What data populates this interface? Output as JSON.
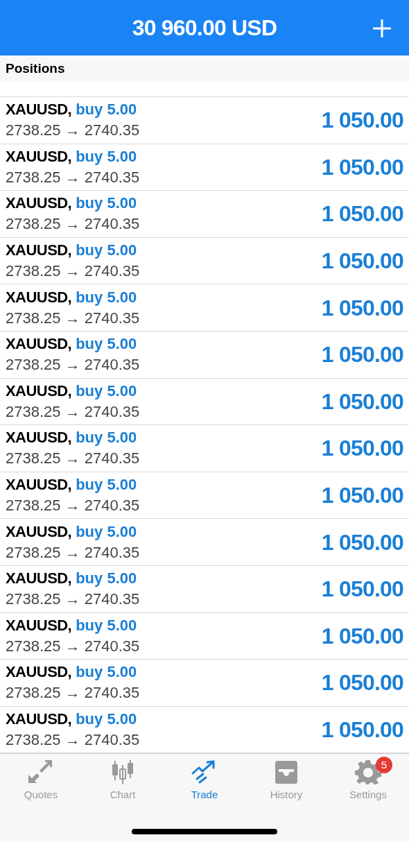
{
  "header": {
    "balance": "30 960.00 USD"
  },
  "section": {
    "title": "Positions"
  },
  "positions": [
    {
      "symbol": "XAUUSD,",
      "order": "buy 5.00",
      "prices": "2738.25 → 2740.35",
      "profit": "1 050.00"
    },
    {
      "symbol": "XAUUSD,",
      "order": "buy 5.00",
      "prices": "2738.25 → 2740.35",
      "profit": "1 050.00"
    },
    {
      "symbol": "XAUUSD,",
      "order": "buy 5.00",
      "prices": "2738.25 → 2740.35",
      "profit": "1 050.00"
    },
    {
      "symbol": "XAUUSD,",
      "order": "buy 5.00",
      "prices": "2738.25 → 2740.35",
      "profit": "1 050.00"
    },
    {
      "symbol": "XAUUSD,",
      "order": "buy 5.00",
      "prices": "2738.25 → 2740.35",
      "profit": "1 050.00"
    },
    {
      "symbol": "XAUUSD,",
      "order": "buy 5.00",
      "prices": "2738.25 → 2740.35",
      "profit": "1 050.00"
    },
    {
      "symbol": "XAUUSD,",
      "order": "buy 5.00",
      "prices": "2738.25 → 2740.35",
      "profit": "1 050.00"
    },
    {
      "symbol": "XAUUSD,",
      "order": "buy 5.00",
      "prices": "2738.25 → 2740.35",
      "profit": "1 050.00"
    },
    {
      "symbol": "XAUUSD,",
      "order": "buy 5.00",
      "prices": "2738.25 → 2740.35",
      "profit": "1 050.00"
    },
    {
      "symbol": "XAUUSD,",
      "order": "buy 5.00",
      "prices": "2738.25 → 2740.35",
      "profit": "1 050.00"
    },
    {
      "symbol": "XAUUSD,",
      "order": "buy 5.00",
      "prices": "2738.25 → 2740.35",
      "profit": "1 050.00"
    },
    {
      "symbol": "XAUUSD,",
      "order": "buy 5.00",
      "prices": "2738.25 → 2740.35",
      "profit": "1 050.00"
    },
    {
      "symbol": "XAUUSD,",
      "order": "buy 5.00",
      "prices": "2738.25 → 2740.35",
      "profit": "1 050.00"
    },
    {
      "symbol": "XAUUSD,",
      "order": "buy 5.00",
      "prices": "2738.25 → 2740.35",
      "profit": "1 050.00"
    }
  ],
  "tab_bar": [
    {
      "kind": "quotes",
      "label": "Quotes",
      "selected": false
    },
    {
      "kind": "chart",
      "label": "Chart",
      "selected": false
    },
    {
      "kind": "trade",
      "label": "Trade",
      "selected": true
    },
    {
      "kind": "history",
      "label": "History",
      "selected": false
    },
    {
      "kind": "settings",
      "label": "Settings",
      "selected": false,
      "badge": "5"
    }
  ]
}
